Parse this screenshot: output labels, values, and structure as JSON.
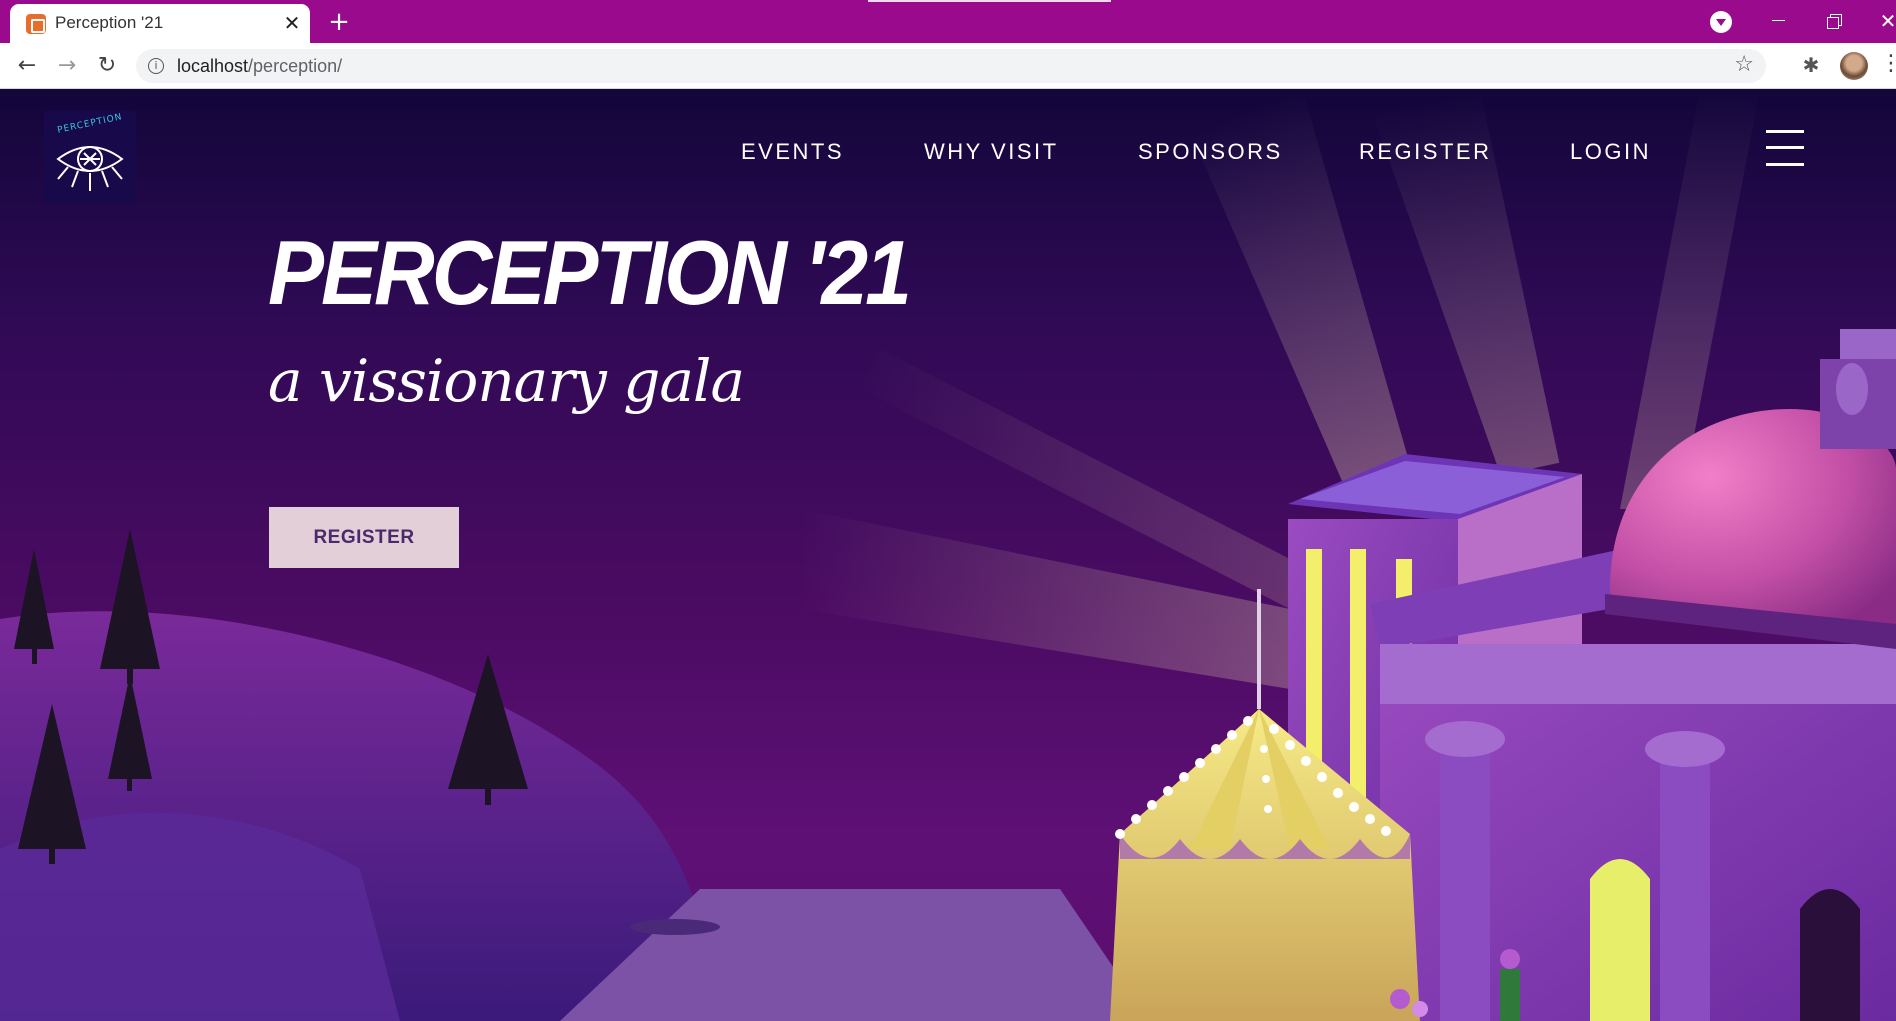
{
  "browser": {
    "tab_title": "Perception '21",
    "tab_close": "✕",
    "new_tab": "+",
    "url_host": "localhost",
    "url_path": "/perception/",
    "window_close": "✕",
    "back": "←",
    "forward": "→",
    "reload": "↻",
    "info": "i",
    "star": "☆",
    "extensions": "✱"
  },
  "logo": {
    "text": "PERCEPTION"
  },
  "nav": {
    "events": "EVENTS",
    "why_visit": "WHY VISIT",
    "sponsors": "SPONSORS",
    "register": "REGISTER",
    "login": "LOGIN"
  },
  "hero": {
    "title": "PERCEPTION '21",
    "subtitle": "a vissionary gala",
    "cta": "REGISTER"
  },
  "colors": {
    "tabstrip": "#9a0a8c",
    "hero_bg_top": "#12063a",
    "hero_bg_bottom": "#5b0d6e",
    "cta_bg": "#e3cfd8",
    "cta_text": "#4a2a6a",
    "accent_yellow": "#f4ef6a",
    "dome_pink": "#d45cb0"
  }
}
